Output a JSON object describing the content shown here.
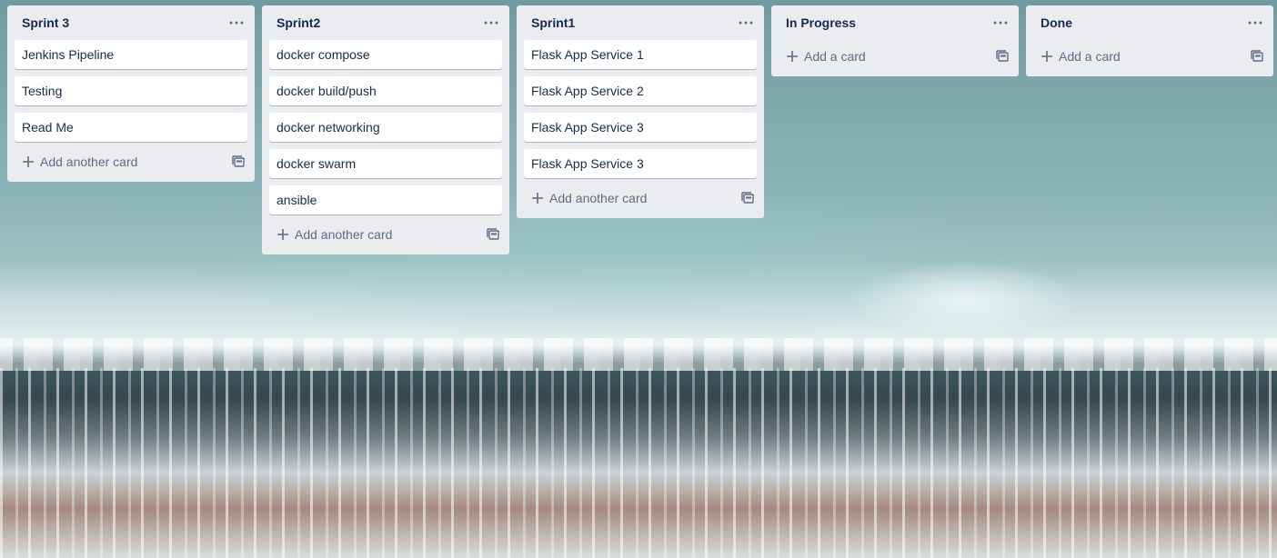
{
  "board": {
    "lists": [
      {
        "title": "Sprint 3",
        "cards": [
          "Jenkins Pipeline",
          "Testing",
          "Read Me"
        ],
        "add_label": "Add another card"
      },
      {
        "title": "Sprint2",
        "cards": [
          "docker compose",
          "docker build/push",
          "docker networking",
          "docker swarm",
          "ansible"
        ],
        "add_label": "Add another card"
      },
      {
        "title": "Sprint1",
        "cards": [
          "Flask App Service 1",
          "Flask App Service 2",
          "Flask App Service 3",
          "Flask App Service 3"
        ],
        "add_label": "Add another card"
      },
      {
        "title": "In Progress",
        "cards": [],
        "add_label": "Add a card"
      },
      {
        "title": "Done",
        "cards": [],
        "add_label": "Add a card"
      }
    ]
  },
  "icons": {
    "list_menu": "ellipsis-icon",
    "add": "plus-icon",
    "template": "card-template-icon"
  },
  "colors": {
    "list_bg": "#ebecf0",
    "card_bg": "#ffffff",
    "title_text": "#172b4d",
    "muted_text": "#5e6c84"
  }
}
